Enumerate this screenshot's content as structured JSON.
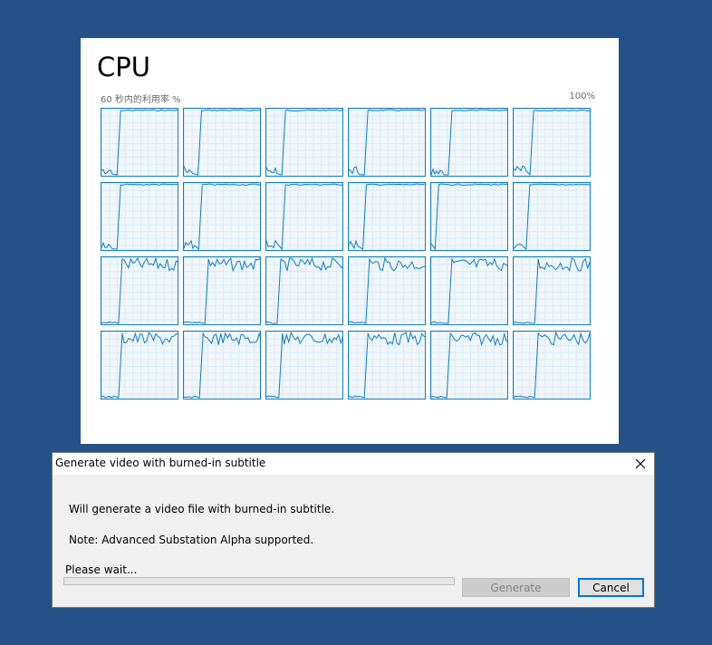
{
  "cpu_panel": {
    "title": "CPU",
    "subtitle": "60 秒内的利用率 %",
    "max_label": "100%",
    "core_count": 24,
    "colors": {
      "graph_line": "#117dbb",
      "graph_bg": "#f1f6fa",
      "grid": "#d9eaf4"
    }
  },
  "dialog": {
    "title": "Generate video with burned-in subtitle",
    "close_icon": "close-icon",
    "message_1": "Will generate a video file with burned-in subtitle.",
    "message_2": "Note: Advanced Substation Alpha supported.",
    "status": "Please wait...",
    "progress": 0,
    "generate_label": "Generate",
    "cancel_label": "Cancel"
  },
  "desktop": {
    "background": "#245288"
  }
}
